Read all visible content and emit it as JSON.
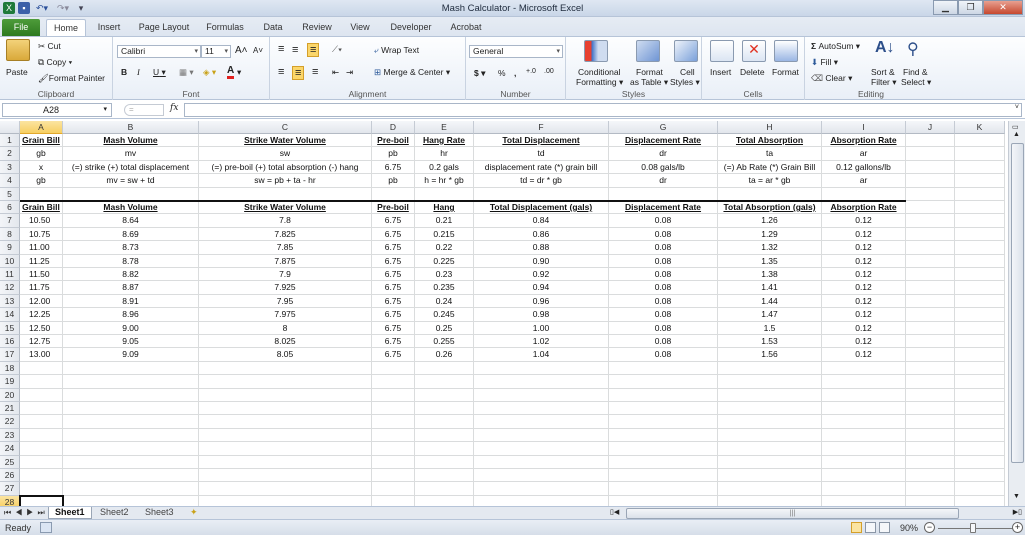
{
  "window": {
    "title": "Mash Calculator - Microsoft Excel",
    "controls": [
      "minimize",
      "maximize",
      "close"
    ]
  },
  "ribbon_tabs": [
    "File",
    "Home",
    "Insert",
    "Page Layout",
    "Formulas",
    "Data",
    "Review",
    "View",
    "Developer",
    "Acrobat"
  ],
  "active_tab": "Home",
  "ribbon": {
    "clipboard": {
      "label": "Clipboard",
      "paste": "Paste",
      "cut": "Cut",
      "copy": "Copy",
      "format_painter": "Format Painter"
    },
    "font": {
      "label": "Font",
      "name": "Calibri",
      "size": "11",
      "bold": "B",
      "italic": "I",
      "underline": "U"
    },
    "alignment": {
      "label": "Alignment",
      "wrap_text": "Wrap Text",
      "merge_center": "Merge & Center"
    },
    "number": {
      "label": "Number",
      "format": "General",
      "currency": "$",
      "percent": "%",
      "comma": ","
    },
    "styles": {
      "label": "Styles",
      "conditional": "Conditional",
      "conditional2": "Formatting",
      "format_table": "Format",
      "format_table2": "as Table",
      "cell_styles": "Cell",
      "cell_styles2": "Styles"
    },
    "cells": {
      "label": "Cells",
      "insert": "Insert",
      "delete": "Delete",
      "format": "Format"
    },
    "editing": {
      "label": "Editing",
      "autosum": "AutoSum",
      "fill": "Fill",
      "clear": "Clear",
      "sort": "Sort &",
      "sort2": "Filter",
      "find": "Find &",
      "find2": "Select"
    }
  },
  "formula_bar": {
    "name_box": "A28",
    "fx": "fx",
    "formula": ""
  },
  "columns": [
    "A",
    "B",
    "C",
    "D",
    "E",
    "F",
    "G",
    "H",
    "I",
    "J",
    "K"
  ],
  "selected_column": "A",
  "selected_row": 28,
  "row_numbers": [
    1,
    2,
    3,
    4,
    5,
    6,
    7,
    8,
    9,
    10,
    11,
    12,
    13,
    14,
    15,
    16,
    17,
    18,
    19,
    20,
    21,
    22,
    23,
    24,
    25,
    26,
    27,
    28
  ],
  "top_table": {
    "headers": [
      "Grain Bill",
      "Mash Volume",
      "Strike Water Volume",
      "Pre-boil",
      "Hang Rate",
      "Total Displacement",
      "Displacement Rate",
      "Total Absorption",
      "Absorption Rate"
    ],
    "rows": [
      [
        "gb",
        "mv",
        "sw",
        "pb",
        "hr",
        "td",
        "dr",
        "ta",
        "ar"
      ],
      [
        "x",
        "(=) strike (+) total displacement",
        "(=) pre-boil (+) total absorption (-) hang",
        "6.75",
        "0.2 gals",
        "displacement rate (*) grain bill",
        "0.08 gals/lb",
        "(=) Ab Rate (*) Grain Bill",
        "0.12 gallons/lb"
      ],
      [
        "gb",
        "mv = sw + td",
        "sw = pb + ta - hr",
        "pb",
        "h = hr * gb",
        "td = dr * gb",
        "dr",
        "ta = ar * gb",
        "ar"
      ]
    ]
  },
  "main_table": {
    "headers": [
      "Grain Bill",
      "Mash Volume",
      "Strike Water Volume",
      "Pre-boil",
      "Hang",
      "Total Displacement (gals)",
      "Displacement Rate",
      "Total Absorption (gals)",
      " Absorption Rate"
    ],
    "rows": [
      [
        "10.50",
        "8.64",
        "7.8",
        "6.75",
        "0.21",
        "0.84",
        "0.08",
        "1.26",
        "0.12"
      ],
      [
        "10.75",
        "8.69",
        "7.825",
        "6.75",
        "0.215",
        "0.86",
        "0.08",
        "1.29",
        "0.12"
      ],
      [
        "11.00",
        "8.73",
        "7.85",
        "6.75",
        "0.22",
        "0.88",
        "0.08",
        "1.32",
        "0.12"
      ],
      [
        "11.25",
        "8.78",
        "7.875",
        "6.75",
        "0.225",
        "0.90",
        "0.08",
        "1.35",
        "0.12"
      ],
      [
        "11.50",
        "8.82",
        "7.9",
        "6.75",
        "0.23",
        "0.92",
        "0.08",
        "1.38",
        "0.12"
      ],
      [
        "11.75",
        "8.87",
        "7.925",
        "6.75",
        "0.235",
        "0.94",
        "0.08",
        "1.41",
        "0.12"
      ],
      [
        "12.00",
        "8.91",
        "7.95",
        "6.75",
        "0.24",
        "0.96",
        "0.08",
        "1.44",
        "0.12"
      ],
      [
        "12.25",
        "8.96",
        "7.975",
        "6.75",
        "0.245",
        "0.98",
        "0.08",
        "1.47",
        "0.12"
      ],
      [
        "12.50",
        "9.00",
        "8",
        "6.75",
        "0.25",
        "1.00",
        "0.08",
        "1.5",
        "0.12"
      ],
      [
        "12.75",
        "9.05",
        "8.025",
        "6.75",
        "0.255",
        "1.02",
        "0.08",
        "1.53",
        "0.12"
      ],
      [
        "13.00",
        "9.09",
        "8.05",
        "6.75",
        "0.26",
        "1.04",
        "0.08",
        "1.56",
        "0.12"
      ]
    ]
  },
  "sheets": [
    "Sheet1",
    "Sheet2",
    "Sheet3"
  ],
  "active_sheet": "Sheet1",
  "status": {
    "mode": "Ready",
    "zoom": "90%",
    "zoom_percent": 90
  }
}
